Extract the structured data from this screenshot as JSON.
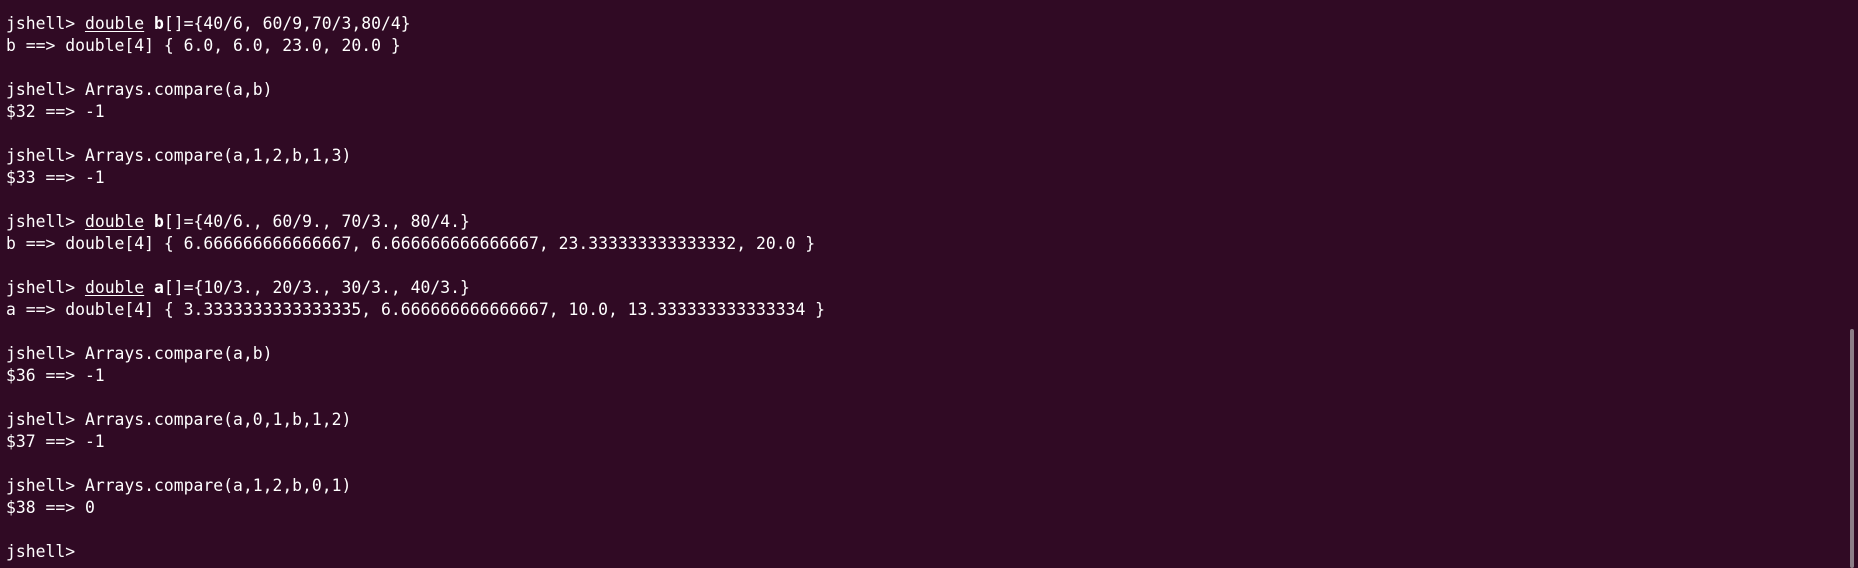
{
  "terminal": {
    "prompt": "jshell> ",
    "entries": [
      {
        "keyword": "double",
        "ident": "b",
        "rest": "[]={40/6, 60/9,70/3,80/4}",
        "output": "b ==> double[4] { 6.0, 6.0, 23.0, 20.0 }"
      },
      {
        "cmd": "Arrays.compare(a,b)",
        "output": "$32 ==> -1"
      },
      {
        "cmd": "Arrays.compare(a,1,2,b,1,3)",
        "output": "$33 ==> -1"
      },
      {
        "keyword": "double",
        "ident": "b",
        "rest": "[]={40/6., 60/9., 70/3., 80/4.}",
        "output": "b ==> double[4] { 6.666666666666667, 6.666666666666667, 23.333333333333332, 20.0 }"
      },
      {
        "keyword": "double",
        "ident": "a",
        "rest": "[]={10/3., 20/3., 30/3., 40/3.}",
        "output": "a ==> double[4] { 3.3333333333333335, 6.666666666666667, 10.0, 13.333333333333334 }"
      },
      {
        "cmd": "Arrays.compare(a,b)",
        "output": "$36 ==> -1"
      },
      {
        "cmd": "Arrays.compare(a,0,1,b,1,2)",
        "output": "$37 ==> -1"
      },
      {
        "cmd": "Arrays.compare(a,1,2,b,0,1)",
        "output": "$38 ==> 0"
      }
    ]
  }
}
